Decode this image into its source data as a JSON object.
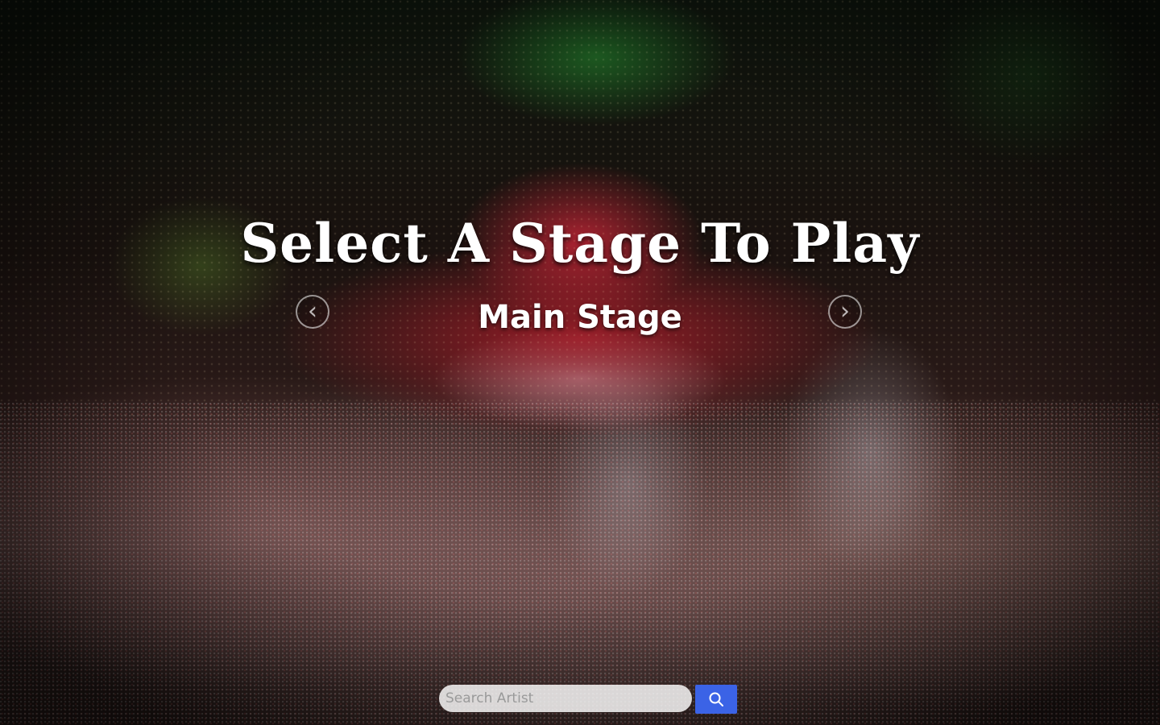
{
  "hero": {
    "headline": "Select A Stage To Play",
    "stage_name": "Main Stage"
  },
  "carousel": {
    "prev_icon": "chevron-left-icon",
    "prev_glyph": "‹",
    "next_icon": "chevron-right-icon",
    "next_glyph": "›"
  },
  "search": {
    "placeholder": "Search Artist",
    "value": "",
    "button_icon": "search-icon",
    "button_color": "#3b63e6"
  }
}
